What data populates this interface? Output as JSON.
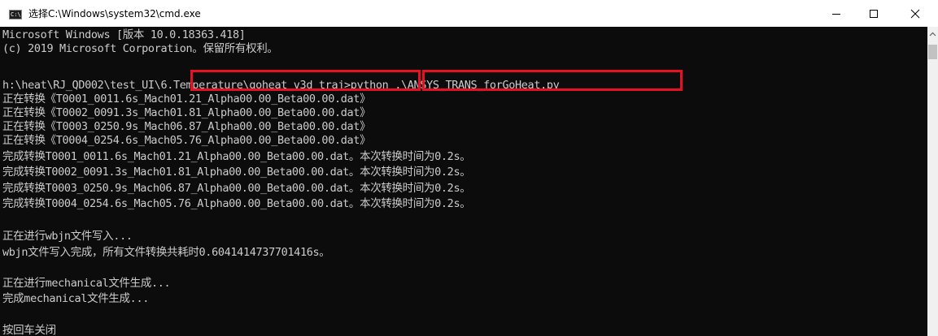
{
  "window": {
    "icon_text": "C:\\",
    "title": "选择C:\\Windows\\system32\\cmd.exe"
  },
  "window_controls": {
    "minimize_icon": "minimize-icon",
    "maximize_icon": "maximize-icon",
    "close_icon": "close-icon"
  },
  "console": {
    "lines": [
      "Microsoft Windows [版本 10.0.18363.418]",
      "(c) 2019 Microsoft Corporation。保留所有权利。",
      "",
      "h:\\heat\\RJ_QD002\\test_UI\\6.Temperature\\goheat_v3d_traj>python .\\ANSYS_TRANS_forGoHeat.py",
      "正在转换《T0001_0011.6s_Mach01.21_Alpha00.00_Beta00.00.dat》",
      "正在转换《T0002_0091.3s_Mach01.81_Alpha00.00_Beta00.00.dat》",
      "正在转换《T0003_0250.9s_Mach06.87_Alpha00.00_Beta00.00.dat》",
      "正在转换《T0004_0254.6s_Mach05.76_Alpha00.00_Beta00.00.dat》",
      "完成转换T0001_0011.6s_Mach01.21_Alpha00.00_Beta00.00.dat。本次转换时间为0.2s。",
      "完成转换T0002_0091.3s_Mach01.81_Alpha00.00_Beta00.00.dat。本次转换时间为0.2s。",
      "完成转换T0003_0250.9s_Mach06.87_Alpha00.00_Beta00.00.dat。本次转换时间为0.2s。",
      "完成转换T0004_0254.6s_Mach05.76_Alpha00.00_Beta00.00.dat。本次转换时间为0.2s。",
      "",
      "正在进行wbjn文件写入...",
      "wbjn文件写入完成，所有文件转换共耗时0.6041414737701416s。",
      "",
      "正在进行mechanical文件生成...",
      "完成mechanical文件生成...",
      "",
      "按回车关闭"
    ]
  },
  "annotations": {
    "highlight_color": "#e81123"
  },
  "colors": {
    "console_background": "#0c0c0c",
    "console_text": "#cccccc",
    "titlebar_background": "#ffffff"
  }
}
